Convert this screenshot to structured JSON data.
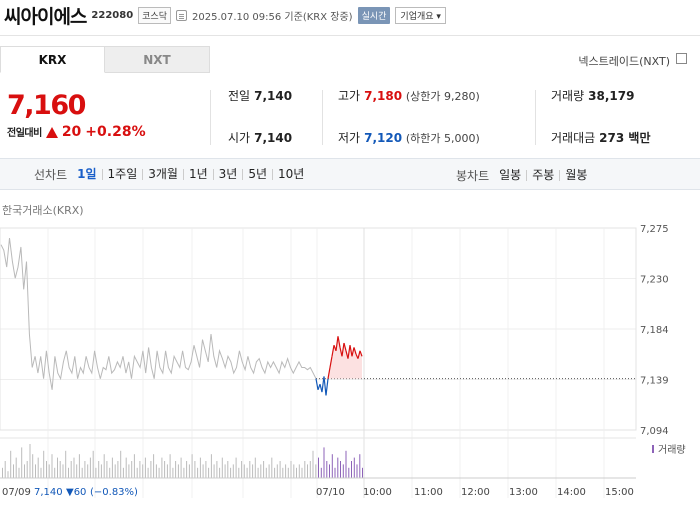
{
  "header": {
    "stock_name": "씨아이에스",
    "stock_code": "222080",
    "market_badge": "코스닥",
    "datetime": "2025.07.10 09:56 기준(KRX 장중)",
    "realtime_label": "실시간",
    "company_button": "기업개요 ▾"
  },
  "tabs": {
    "krx": "KRX",
    "nxt": "NXT",
    "next_link": "넥스트레이드(NXT)"
  },
  "quote": {
    "price": "7,160",
    "change_label": "전일대비",
    "change_value": "20",
    "change_rate": "+0.28%"
  },
  "stats": {
    "prev_close_label": "전일",
    "prev_close": "7,140",
    "open_label": "시가",
    "open": "7,140",
    "high_label": "고가",
    "high": "7,180",
    "upper_limit": "(상한가 9,280)",
    "low_label": "저가",
    "low": "7,120",
    "lower_limit": "(하한가 5,000)",
    "volume_label": "거래량",
    "volume": "38,179",
    "amount_label": "거래대금",
    "amount": "273 백만"
  },
  "periods": {
    "line_label": "선차트",
    "line_items": [
      "1일",
      "1주일",
      "3개월",
      "1년",
      "3년",
      "5년",
      "10년"
    ],
    "selected": "1일",
    "candle_label": "봉차트",
    "candle_items": [
      "일봉",
      "주봉",
      "월봉"
    ]
  },
  "market_label": "한국거래소(KRX)",
  "colors": {
    "up": "#d80f0f",
    "down": "#1258b8",
    "history": "#b9b9b9",
    "volume": "#8d63b8"
  },
  "chart_data": {
    "type": "line",
    "y_ticks": [
      "7,275",
      "7,230",
      "7,184",
      "7,139",
      "7,094"
    ],
    "ylim": [
      7094,
      7275
    ],
    "x_labels": [
      "07/09",
      "07/10",
      "10:00",
      "11:00",
      "12:00",
      "13:00",
      "14:00",
      "15:00"
    ],
    "prev_day_note": {
      "date": "07/09",
      "close": "7,140",
      "change": "▼60",
      "rate": "(−0.83%)"
    },
    "volume_label": "거래량",
    "reference_price": 7140,
    "series": [
      {
        "values": [
          7260,
          7255,
          7240,
          7266,
          7245,
          7230,
          7240,
          7258,
          7220,
          7245,
          7180,
          7150,
          7160,
          7145,
          7160,
          7140,
          7165,
          7145,
          7130,
          7160,
          7145,
          7140,
          7155,
          7165,
          7150,
          7145,
          7160,
          7140,
          7150,
          7145,
          7160,
          7150,
          7145,
          7165,
          7150,
          7140,
          7150,
          7148,
          7160,
          7145,
          7148,
          7155,
          7150,
          7160,
          7145,
          7155,
          7140,
          7160,
          7155,
          7150,
          7165,
          7145,
          7168,
          7150,
          7140,
          7165,
          7150,
          7145,
          7165,
          7150,
          7145,
          7160,
          7155,
          7150,
          7165,
          7150,
          7148,
          7155,
          7170,
          7160,
          7150,
          7175,
          7165,
          7155,
          7180,
          7160,
          7150,
          7165,
          7158,
          7150,
          7160,
          7155,
          7145,
          7150,
          7165,
          7155,
          7148,
          7160,
          7150,
          7145,
          7155,
          7158,
          7150,
          7145,
          7155,
          7150,
          7155,
          7150,
          7145,
          7155,
          7150,
          7158,
          7150,
          7145,
          7150,
          7155,
          7150,
          7150,
          7148,
          7150,
          7145,
          7140
        ]
      },
      {
        "values": [
          7140,
          7130,
          7135,
          7128,
          7142,
          7125,
          7140,
          7150,
          7160,
          7170,
          7165,
          7178,
          7168,
          7160,
          7172,
          7165,
          7158,
          7170,
          7160,
          7168,
          7162,
          7158,
          7165,
          7160
        ]
      }
    ],
    "volume": [
      3,
      5,
      2,
      8,
      4,
      6,
      3,
      9,
      4,
      5,
      10,
      7,
      4,
      6,
      3,
      8,
      5,
      4,
      7,
      3,
      6,
      5,
      4,
      8,
      3,
      5,
      6,
      4,
      7,
      3,
      5,
      4,
      6,
      8,
      3,
      5,
      4,
      7,
      5,
      3,
      6,
      4,
      5,
      8,
      3,
      6,
      4,
      5,
      7,
      3,
      5,
      4,
      6,
      3,
      5,
      7,
      4,
      3,
      6,
      5,
      4,
      7,
      3,
      5,
      4,
      6,
      3,
      5,
      4,
      7,
      5,
      3,
      6,
      4,
      5,
      3,
      7,
      4,
      5,
      3,
      6,
      4,
      5,
      3,
      4,
      6,
      3,
      5,
      4,
      3,
      5,
      4,
      6,
      3,
      4,
      5,
      3,
      4,
      6,
      3,
      4,
      5,
      3,
      4,
      3,
      5,
      4,
      3,
      4,
      3,
      5,
      4,
      5,
      8,
      4,
      6,
      3,
      9,
      5,
      4,
      7,
      3,
      6,
      5,
      4,
      8,
      3,
      5,
      6,
      4,
      7,
      3
    ]
  }
}
